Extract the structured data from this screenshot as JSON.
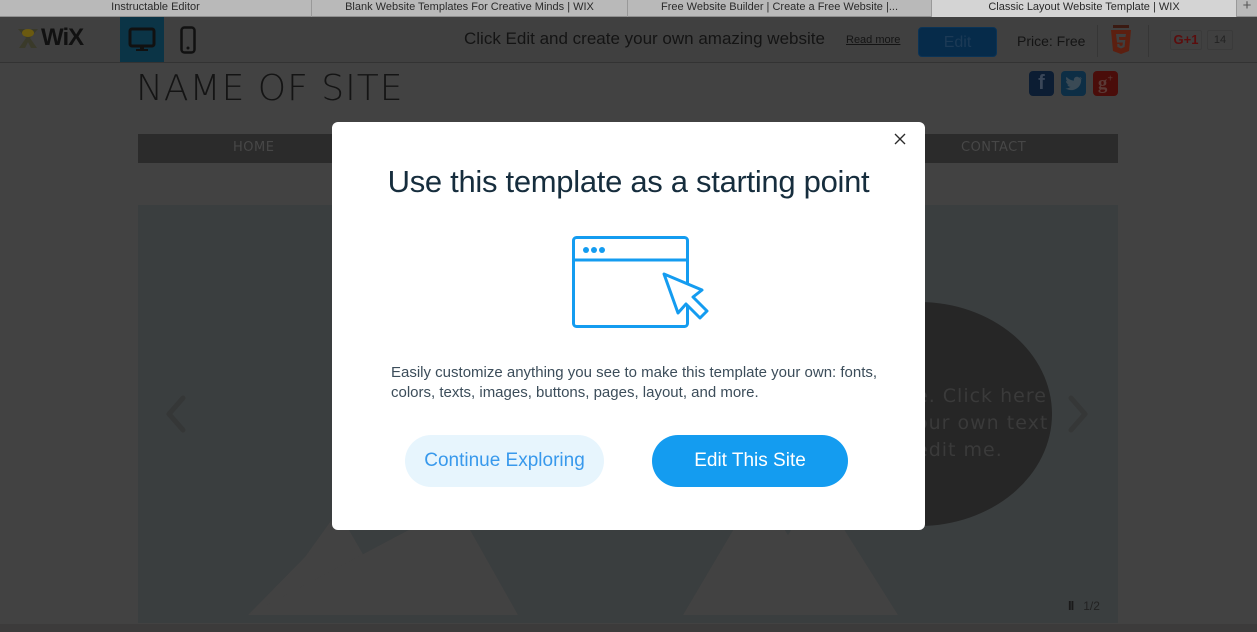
{
  "browser": {
    "tabs": [
      {
        "label": "Instructable Editor",
        "active": false
      },
      {
        "label": "Blank Website Templates For Creative Minds | WIX",
        "active": false
      },
      {
        "label": "Free Website Builder | Create a Free Website |...",
        "active": false
      },
      {
        "label": "Classic Layout Website Template | WIX",
        "active": true
      }
    ],
    "new_tab_label": "+"
  },
  "toolbar": {
    "logo_text": "WiX",
    "device_desktop_icon": "desktop-monitor-icon",
    "device_mobile_icon": "mobile-phone-icon",
    "promo_text": "Click Edit and create your own amazing website",
    "read_more_label": "Read more",
    "edit_label": "Edit",
    "price_text": "Price: Free",
    "html5_icon": "html5-badge-icon",
    "gplus_label": "G+1",
    "gplus_count": "14"
  },
  "site": {
    "title": "NAME OF SITE",
    "social": [
      {
        "name": "facebook",
        "glyph": "f",
        "color": "#0c1d33"
      },
      {
        "name": "twitter",
        "glyph": "t",
        "color": "#0d2e45"
      },
      {
        "name": "google-plus",
        "glyph": "g+",
        "color": "#4a0d0a"
      }
    ],
    "nav": [
      "HOME",
      "CONTACT"
    ],
    "slide_text": [
      "e. Click here",
      "our own text",
      "edit me."
    ],
    "pager": {
      "pause_glyph": "II",
      "current": "1/2"
    }
  },
  "modal": {
    "title": "Use this template as a starting point",
    "description": "Easily customize anything you see to make this template your own: fonts, colors, texts, images, buttons, pages, layout, and more.",
    "continue_label": "Continue Exploring",
    "edit_label": "Edit This Site",
    "accent_color": "#149cf0",
    "close_icon": "close-icon"
  }
}
